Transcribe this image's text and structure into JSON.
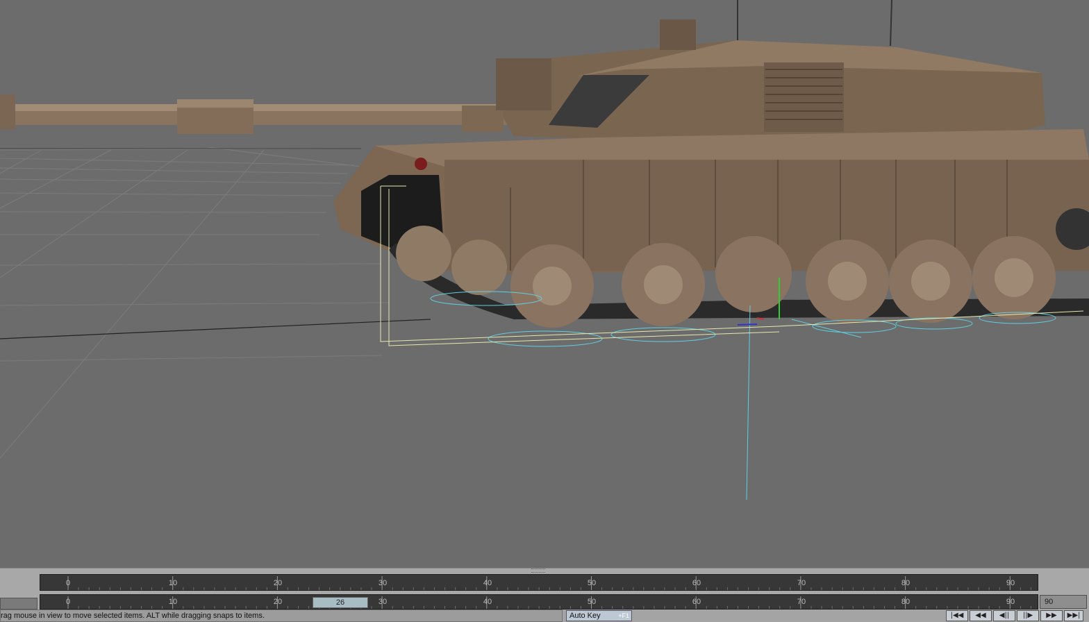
{
  "timeline": {
    "ruler_labels": [
      "0",
      "10",
      "20",
      "30",
      "40",
      "50",
      "60",
      "70",
      "80",
      "90"
    ],
    "current_frame": "26",
    "end_frame": "90"
  },
  "statusbar": {
    "message": "rag mouse in view to move selected items. ALT while dragging snaps to items.",
    "autokey_label": "Auto Key",
    "autokey_shortcut": "+F1"
  },
  "transport": {
    "buttons": [
      {
        "icon": "first-frame-icon",
        "glyph": "|◀◀"
      },
      {
        "icon": "rewind-icon",
        "glyph": "◀◀"
      },
      {
        "icon": "step-back-icon",
        "glyph": "◀||"
      },
      {
        "icon": "step-forward-icon",
        "glyph": "||▶"
      },
      {
        "icon": "play-forward-icon",
        "glyph": "▶▶"
      },
      {
        "icon": "last-frame-icon",
        "glyph": "▶▶|"
      }
    ]
  }
}
